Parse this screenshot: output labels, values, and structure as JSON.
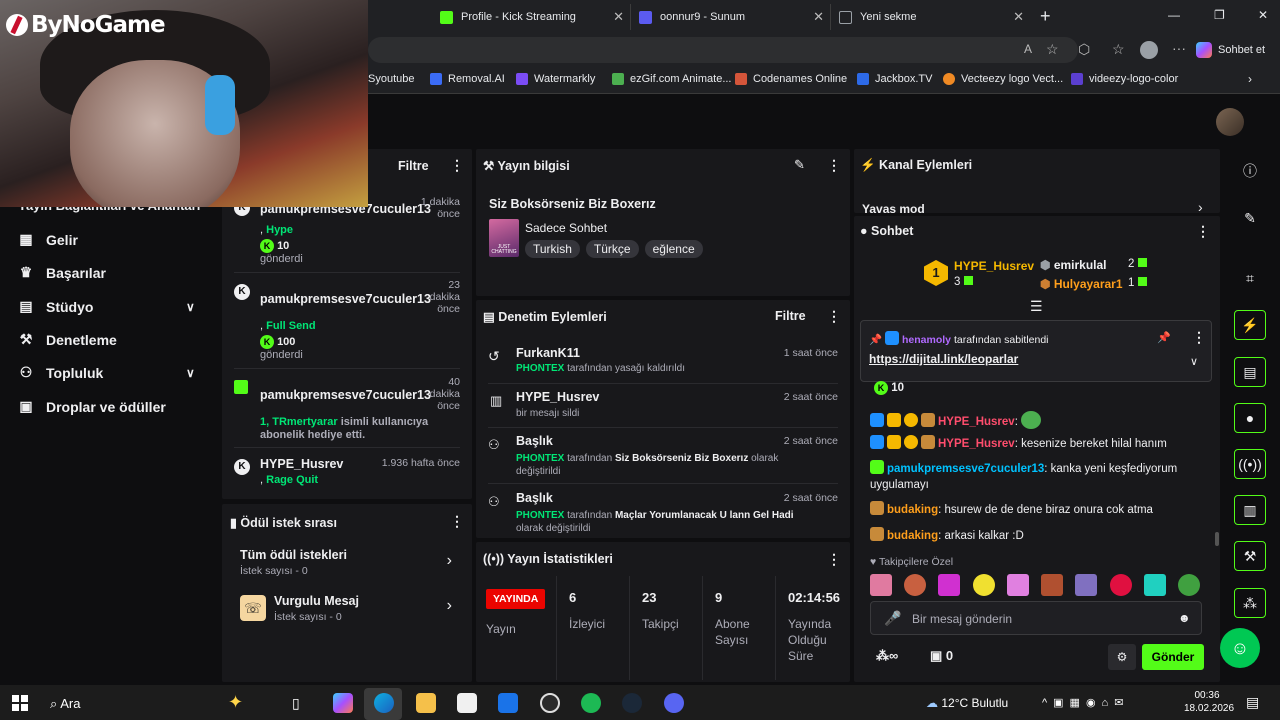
{
  "browser": {
    "tabs": [
      {
        "label": "Profile - Kick Streaming",
        "icon": "kick-icon",
        "color": "#53fc18"
      },
      {
        "label": "oonnur9 - Sunum",
        "icon": "shield-icon",
        "color": "#5b5bf0"
      },
      {
        "label": "Yeni sekme",
        "icon": "new-tab-icon",
        "color": "#9aa0a6"
      }
    ],
    "new_tab": "+",
    "window_controls": [
      "—",
      "❐",
      "✕"
    ],
    "sohbet_et": "Sohbet et",
    "bookmarks": [
      {
        "label": "Syoutube",
        "color": "#ff0000"
      },
      {
        "label": "Removal.AI",
        "color": "#3b6cf6"
      },
      {
        "label": "Watermarkly",
        "color": "#7b4cf5"
      },
      {
        "label": "ezGif.com Animate...",
        "color": "#4caf50"
      },
      {
        "label": "Codenames Online",
        "color": "#d4553a"
      },
      {
        "label": "Jackbox.TV",
        "color": "#2d6ae8"
      },
      {
        "label": "Vecteezy logo Vect...",
        "color": "#f08a24"
      },
      {
        "label": "videezy-logo-color",
        "color": "#5b3fd0"
      }
    ]
  },
  "overlay": {
    "logo_text": "ByNoGame"
  },
  "left_nav": {
    "partial_item": "Yayın Bağlantıları ve Anahtarı",
    "items": [
      {
        "label": "Gelir",
        "icon": "revenue-icon",
        "glyph": "▦"
      },
      {
        "label": "Başarılar",
        "icon": "trophy-icon",
        "glyph": "🏆"
      },
      {
        "label": "Stüdyo",
        "icon": "studio-icon",
        "glyph": "▤",
        "expandable": true
      },
      {
        "label": "Denetleme",
        "icon": "moderation-icon",
        "glyph": "🔨"
      },
      {
        "label": "Topluluk",
        "icon": "community-icon",
        "glyph": "👥",
        "expandable": true
      },
      {
        "label": "Droplar ve ödüller",
        "icon": "gift-icon",
        "glyph": "🎁"
      }
    ]
  },
  "activity": {
    "filter_label": "Filtre",
    "items": [
      {
        "user": "pamukpremsesve7cuculer13",
        "time": "1 dakika önce",
        "detail": "Hype",
        "amount": "10",
        "suffix": "gönderdi"
      },
      {
        "user": "pamukpremsesve7cuculer13",
        "time": "23 dakika önce",
        "detail": "Full Send",
        "amount": "100",
        "suffix": "gönderdi"
      },
      {
        "user": "pamukpremsesve7cuculer13",
        "time": "40 dakika önce",
        "detail": "1, TRmertyarar",
        "text": "isimli kullanıcıya abonelik hediye etti."
      },
      {
        "user": "HYPE_Husrev",
        "time": "1.936 hafta önce",
        "detail": "Rage Quit"
      }
    ]
  },
  "rewards": {
    "title": "Ödül istek sırası",
    "items": [
      {
        "label": "Tüm ödül istekleri",
        "sub": "İstek sayısı - 0"
      },
      {
        "label": "Vurgulu Mesaj",
        "sub": "İstek sayısı - 0"
      }
    ]
  },
  "stream_info": {
    "title": "Yayın bilgisi",
    "stream_title": "Siz Boksörseniz Biz Boxerız",
    "category": "Sadece Sohbet",
    "category_thumb": "JUST CHATTING",
    "tags": [
      "Turkish",
      "Türkçe",
      "eğlence"
    ]
  },
  "mod_actions": {
    "title": "Denetim Eylemleri",
    "filter_label": "Filtre",
    "items": [
      {
        "icon": "undo-icon",
        "glyph": "↺",
        "name": "FurkanK11",
        "time": "1 saat önce",
        "actor": "PHONTEX",
        "text": "tarafından yasağı kaldırıldı"
      },
      {
        "icon": "trash-icon",
        "glyph": "🗑",
        "name": "HYPE_Husrev",
        "time": "2 saat önce",
        "actor": "",
        "text": "bir mesajı sildi"
      },
      {
        "icon": "users-icon",
        "glyph": "👥",
        "name": "Başlık",
        "time": "2 saat önce",
        "actor": "PHONTEX",
        "mid": "tarafından",
        "bold": "Siz Boksörseniz Biz Boxerız",
        "text": "olarak değiştirildi"
      },
      {
        "icon": "users-icon",
        "glyph": "👥",
        "name": "Başlık",
        "time": "2 saat önce",
        "actor": "PHONTEX",
        "mid": "tarafından",
        "bold": "Maçlar Yorumlanacak U lann Gel Hadi",
        "text": "olarak değiştirildi"
      }
    ]
  },
  "stats": {
    "title": "Yayın İstatistikleri",
    "live_badge": "YAYINDA",
    "live_label": "Yayın",
    "items": [
      {
        "value": "6",
        "label": "İzleyici"
      },
      {
        "value": "23",
        "label": "Takipçi"
      },
      {
        "value": "9",
        "label": "Abone Sayısı"
      },
      {
        "value": "02:14:56",
        "label": "Yayında Olduğu Süre"
      }
    ]
  },
  "channel_actions": {
    "title": "Kanal Eylemleri",
    "partial": "Yavaş mod"
  },
  "chat": {
    "title": "Sohbet",
    "leaderboard": [
      {
        "rank": "1",
        "name": "HYPE_Husrev",
        "count": "3"
      },
      {
        "name": "emirkulal",
        "count": "2"
      },
      {
        "name": "Hulyayarar1",
        "count": "1"
      }
    ],
    "pinned_by": "henamoly",
    "pinned_text": "tarafından sabitlendi",
    "pinned_link": "https://dijital.link/leoparlar",
    "partial_amount": "10",
    "messages": [
      {
        "user": "HYPE_Husrev",
        "color": "#ff4d6d",
        "text": "",
        "emote": true
      },
      {
        "user": "HYPE_Husrev",
        "color": "#ff4d6d",
        "text": "kesenize bereket hilal hanım"
      },
      {
        "user": "pamukpremsesve7cuculer13",
        "color": "#00c2ff",
        "text": "kanka yeni keşfediyorum uygulamayı"
      },
      {
        "user": "budaking",
        "color": "#ff9f1c",
        "text": "hsurew de de dene biraz onura cok atma"
      },
      {
        "user": "budaking",
        "color": "#ff9f1c",
        "text": "arkasi kalkar :D"
      }
    ],
    "followers_only": "Takipçilere Özel",
    "input_placeholder": "Bir mesaj gönderin",
    "points": "∞",
    "inventory_count": "0",
    "send_label": "Gönder"
  },
  "taskbar": {
    "search": "Ara",
    "weather": "12°C  Bulutlu",
    "time": "00:36",
    "date": "18.02.2026"
  },
  "colors": {
    "kick_green": "#53fc18",
    "panel": "#18181b",
    "bg": "#0e0e10",
    "live_red": "#eb0400"
  }
}
